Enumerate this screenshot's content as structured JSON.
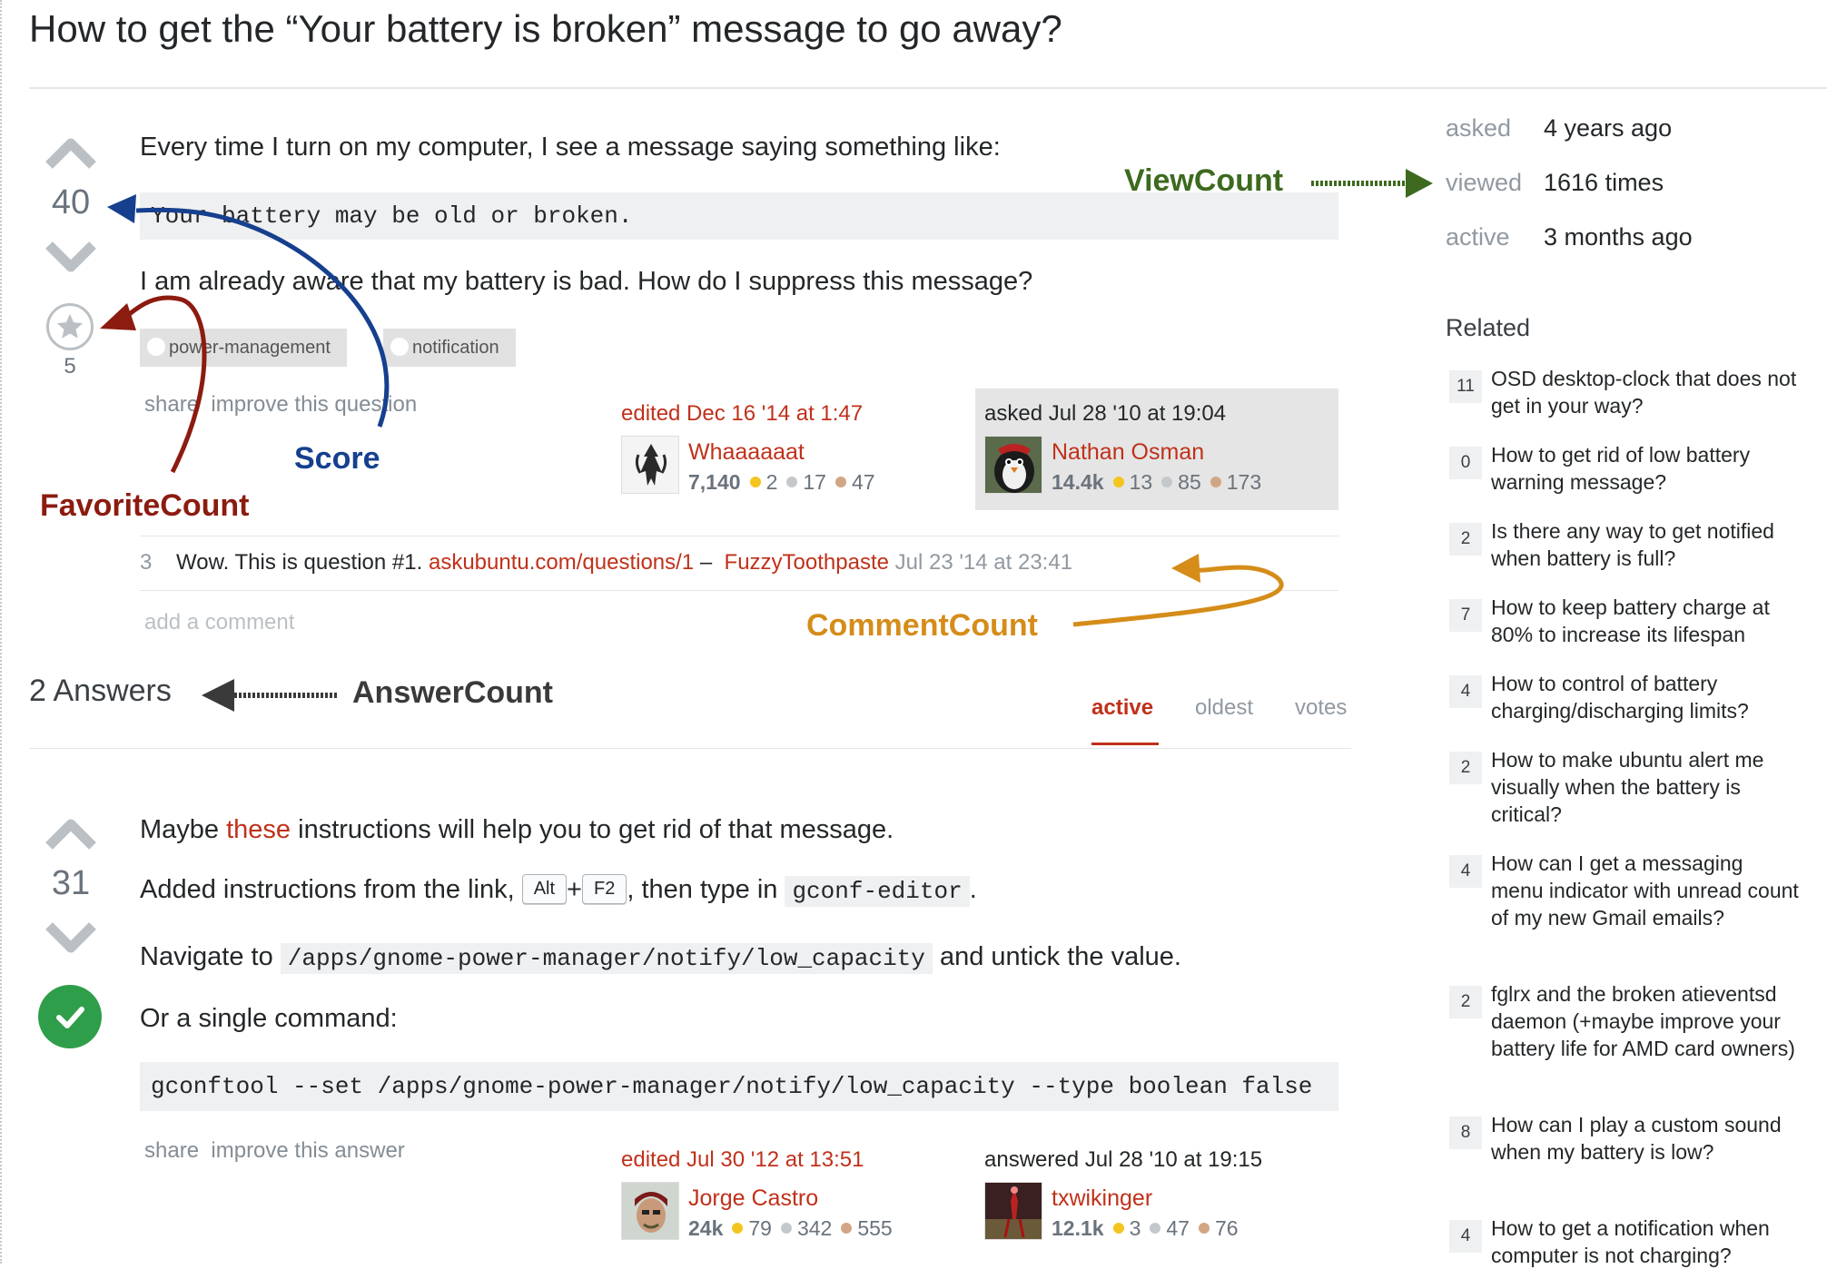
{
  "question": {
    "title": "How to get the “Your battery is broken” message to go away?",
    "score": "40",
    "favorite_count": "5",
    "body_line1": "Every time I turn on my computer, I see a message saying something like:",
    "code": "Your battery may be old or broken.",
    "body_line2": "I am already aware that my battery is bad. How do I suppress this message?",
    "tags": [
      "power-management",
      "notification"
    ],
    "menu": {
      "share": "share",
      "improve": "improve this question"
    },
    "edited": {
      "time": "edited Dec 16 '14 at 1:47",
      "user": "Whaaaaaat",
      "rep": "7,140",
      "gold": "2",
      "silver": "17",
      "bronze": "47"
    },
    "asked": {
      "time": "asked Jul 28 '10 at 19:04",
      "user": "Nathan Osman",
      "rep": "14.4k",
      "gold": "13",
      "silver": "85",
      "bronze": "173"
    },
    "comment": {
      "score": "3",
      "text": "Wow. This is question #1.",
      "link": "askubuntu.com/questions/1",
      "dash": "–",
      "user": "FuzzyToothpaste",
      "time": "Jul 23 '14 at 23:41"
    },
    "add_comment": "add a comment"
  },
  "answers_header": {
    "count_label": "2 Answers",
    "tabs": [
      "active",
      "oldest",
      "votes"
    ],
    "active_tab": "active"
  },
  "answer": {
    "score": "31",
    "line1_pre": "Maybe ",
    "line1_link": "these",
    "line1_post": " instructions will help you to get rid of that message.",
    "line2_pre": "Added instructions from the link, ",
    "key1": "Alt",
    "plus": "+",
    "key2": "F2",
    "line2_mid": ", then type in ",
    "line2_code": "gconf-editor",
    "line2_end": ".",
    "line3_pre": "Navigate to ",
    "line3_code": "/apps/gnome-power-manager/notify/low_capacity",
    "line3_post": " and untick the value.",
    "line4": "Or a single command:",
    "command": "gconftool --set /apps/gnome-power-manager/notify/low_capacity --type boolean false",
    "menu": {
      "share": "share",
      "improve": "improve this answer"
    },
    "edited": {
      "time": "edited Jul 30 '12 at 13:51",
      "user": "Jorge Castro",
      "rep": "24k",
      "gold": "79",
      "silver": "342",
      "bronze": "555"
    },
    "answered": {
      "time": "answered Jul 28 '10 at 19:15",
      "user": "txwikinger",
      "rep": "12.1k",
      "gold": "3",
      "silver": "47",
      "bronze": "76"
    }
  },
  "annotations": {
    "view": "ViewCount",
    "score": "Score",
    "favorite": "FavoriteCount",
    "comment": "CommentCount",
    "answer": "AnswerCount"
  },
  "sidebar": {
    "stats": [
      {
        "label": "asked",
        "value": "4 years ago"
      },
      {
        "label": "viewed",
        "value": "1616 times"
      },
      {
        "label": "active",
        "value": "3 months ago"
      }
    ],
    "related_title": "Related",
    "related": [
      {
        "score": "11",
        "title": "OSD desktop-clock that does not get in your way?"
      },
      {
        "score": "0",
        "title": "How to get rid of low battery warning message?"
      },
      {
        "score": "2",
        "title": "Is there any way to get notified when battery is full?"
      },
      {
        "score": "7",
        "title": "How to keep battery charge at 80% to increase its lifespan"
      },
      {
        "score": "4",
        "title": "How to control of battery charging/discharging limits?"
      },
      {
        "score": "2",
        "title": "How to make ubuntu alert me visually when the battery is critical?"
      },
      {
        "score": "4",
        "title": "How can I get a messaging menu indicator with unread count of my new Gmail emails?"
      },
      {
        "score": "2",
        "title": "fglrx and the broken atieventsd daemon (+maybe improve your battery life for AMD card owners)"
      },
      {
        "score": "8",
        "title": "How can I play a custom sound when my battery is low?"
      },
      {
        "score": "4",
        "title": "How to get a notification when computer is not charging?"
      }
    ]
  },
  "colors": {
    "link": "#c0311a",
    "annot_view": "#3d6a1f",
    "annot_score": "#16408e",
    "annot_favorite": "#8c1b10",
    "annot_comment": "#d58c19",
    "annot_answer": "#3a3a3a",
    "accepted": "#2f9e4a"
  }
}
